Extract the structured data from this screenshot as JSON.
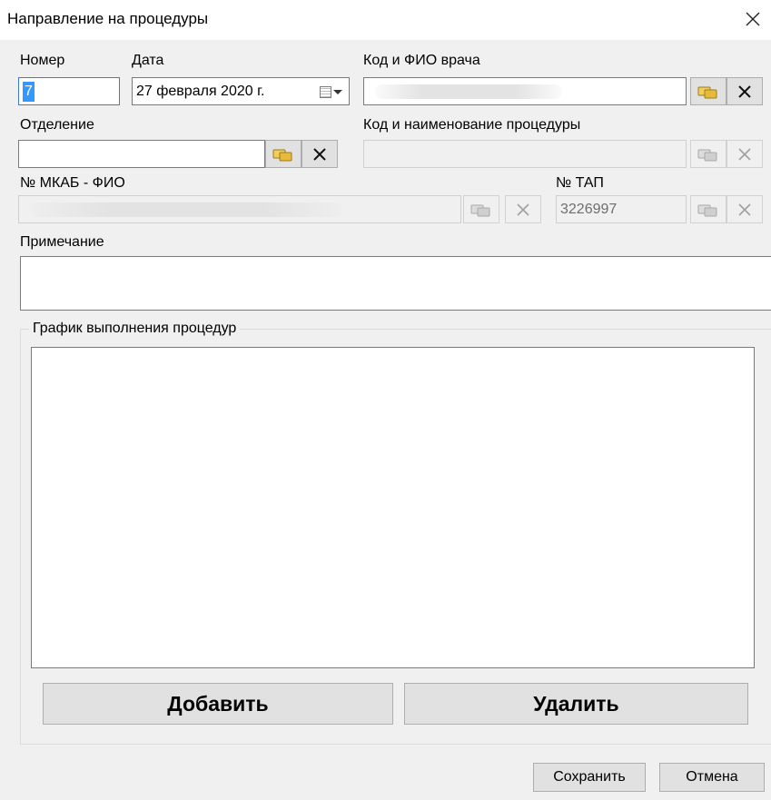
{
  "window": {
    "title": "Направление на процедуры",
    "close_icon": "close-icon"
  },
  "form": {
    "number": {
      "label": "Номер",
      "value": "7"
    },
    "date": {
      "label": "Дата",
      "value": "27 февраля  2020 г.",
      "icon": "calendar-dropdown-icon"
    },
    "doctor": {
      "label": "Код и ФИО врача",
      "value": ""
    },
    "department": {
      "label": "Отделение",
      "value": ""
    },
    "procedure": {
      "label": "Код и наименование процедуры",
      "value": ""
    },
    "mkab": {
      "label": "№ МКАБ - ФИО",
      "value": ""
    },
    "tap": {
      "label": "№ ТАП",
      "value": "3226997"
    },
    "note": {
      "label": "Примечание",
      "value": ""
    }
  },
  "schedule": {
    "title": "График выполнения процедур",
    "add_label": "Добавить",
    "delete_label": "Удалить"
  },
  "footer": {
    "save_label": "Сохранить",
    "cancel_label": "Отмена"
  },
  "icons": {
    "lookup": "lookup-icon",
    "clear": "clear-x-icon"
  },
  "colors": {
    "selection": "#3399ff",
    "lookup_icon": "#e8b93a",
    "background": "#f0f0f0"
  }
}
